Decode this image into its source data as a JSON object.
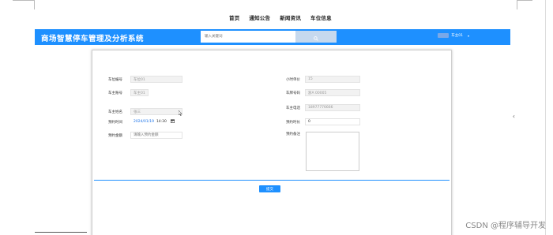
{
  "nav": {
    "items": [
      "首页",
      "通知公告",
      "新闻资讯",
      "车位信息"
    ]
  },
  "header": {
    "title": "商场智慧停车管理及分析系统",
    "search_placeholder": "输入关键词",
    "search_icon": "search-icon",
    "user_name": "车主01",
    "user_caret": "▾",
    "bg_color": "#1e90ff"
  },
  "form": {
    "space_no_label": "车位编号",
    "space_no_value": "车位01",
    "hour_price_label": "小时单价",
    "hour_price_value": "15",
    "owner_account_label": "车主账号",
    "owner_account_value": "车主01",
    "plate_label": "车牌号码",
    "plate_value": "浙A 00005",
    "owner_name_label": "车主姓名",
    "owner_name_value": "张三",
    "owner_phone_label": "车主电话",
    "owner_phone_value": "18977776666",
    "reserve_time_label": "预约时间",
    "reserve_date": "2024/01/19",
    "reserve_clock": "14:30",
    "reserve_hours_label": "预约时长",
    "reserve_hours_value": "0",
    "reserve_amount_label": "预约金额",
    "reserve_amount_placeholder": "请输入预约金额",
    "reserve_note_label": "预约备注",
    "submit_label": "提交"
  },
  "side_arrow": "‹",
  "watermark": "CSDN @程序辅导开发"
}
